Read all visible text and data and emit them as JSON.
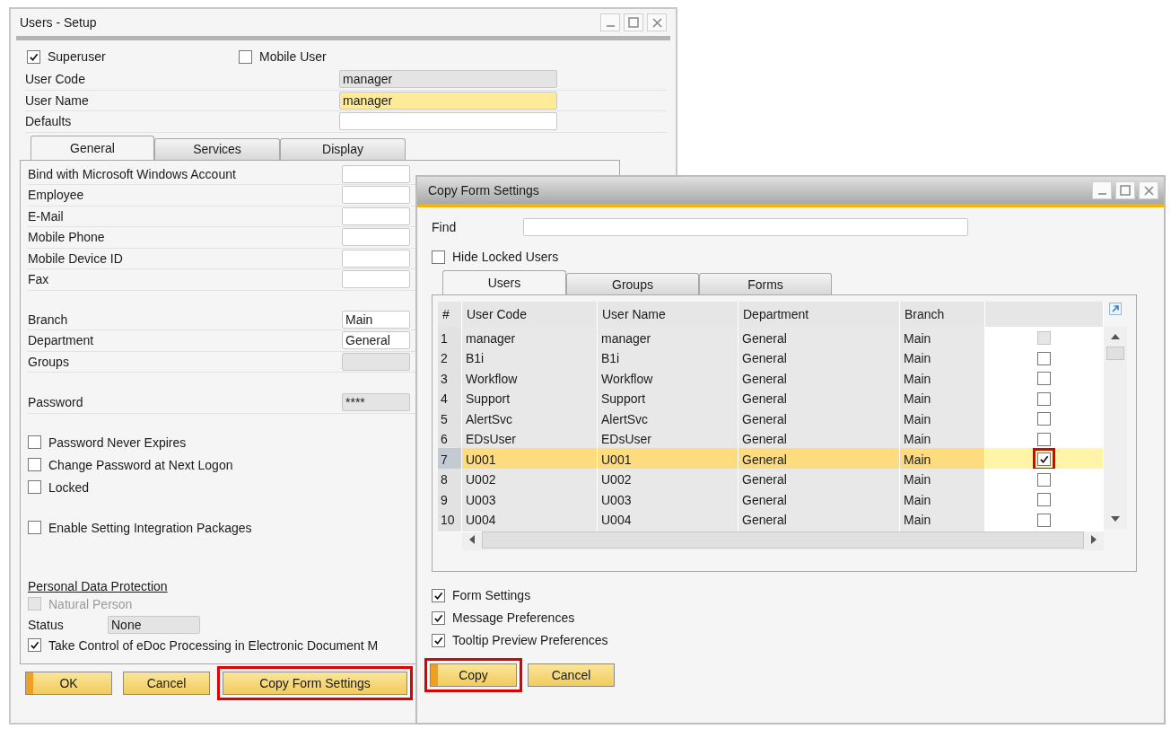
{
  "users_setup": {
    "title": "Users - Setup",
    "top_checks": [
      {
        "label": "Superuser",
        "checked": true
      },
      {
        "label": "Mobile User",
        "checked": false
      }
    ],
    "fields": [
      {
        "label": "User Code",
        "value": "manager",
        "kind": "readonly"
      },
      {
        "label": "User Name",
        "value": "manager",
        "kind": "focused"
      },
      {
        "label": "Defaults",
        "kind": "input"
      }
    ],
    "tabs": [
      {
        "label": "General",
        "selected": true
      },
      {
        "label": "Services",
        "selected": false
      },
      {
        "label": "Display",
        "selected": false
      }
    ],
    "general_field_groups": [
      [
        {
          "label": "Bind with Microsoft Windows Account",
          "kind": "input"
        },
        {
          "label": "Employee",
          "kind": "input"
        },
        {
          "label": "E-Mail",
          "kind": "input"
        },
        {
          "label": "Mobile Phone",
          "kind": "input"
        },
        {
          "label": "Mobile Device ID",
          "kind": "input"
        },
        {
          "label": "Fax",
          "kind": "input"
        }
      ],
      [
        {
          "label": "Branch",
          "value": "Main",
          "kind": "input"
        },
        {
          "label": "Department",
          "value": "General",
          "kind": "input"
        },
        {
          "label": "Groups",
          "kind": "readonly"
        }
      ],
      [
        {
          "label": "Password",
          "value": "****",
          "kind": "readonly"
        }
      ]
    ],
    "option_groups": [
      [
        {
          "label": "Password Never Expires",
          "checked": false
        },
        {
          "label": "Change Password at Next Logon",
          "checked": false
        },
        {
          "label": "Locked",
          "checked": false
        }
      ],
      [
        {
          "label": "Enable Setting Integration Packages",
          "checked": false
        }
      ]
    ],
    "personal_data": {
      "heading": "Personal Data Protection",
      "natural_person": {
        "label": "Natural Person",
        "checked": false,
        "disabled": true
      },
      "status": {
        "label": "Status",
        "value": "None"
      },
      "edoc": {
        "label": "Take Control of eDoc Processing in Electronic Document M",
        "checked": true
      }
    },
    "buttons": [
      {
        "label": "OK",
        "primary": true,
        "highlighted": false
      },
      {
        "label": "Cancel",
        "primary": false,
        "highlighted": false
      },
      {
        "label": "Copy Form Settings",
        "primary": false,
        "highlighted": true
      }
    ]
  },
  "copy_form_settings": {
    "title": "Copy Form Settings",
    "find": {
      "label": "Find"
    },
    "hide_locked": {
      "label": "Hide Locked Users",
      "checked": false
    },
    "tabs": [
      {
        "label": "Users",
        "selected": true
      },
      {
        "label": "Groups",
        "selected": false
      },
      {
        "label": "Forms",
        "selected": false
      }
    ],
    "table": {
      "columns": [
        "#",
        "User Code",
        "User Name",
        "Department",
        "Branch"
      ],
      "rows": [
        {
          "cells": [
            "1",
            "manager",
            "manager",
            "General",
            "Main"
          ],
          "selected": false,
          "checked": false,
          "disabled": true,
          "highlighted": false
        },
        {
          "cells": [
            "2",
            "B1i",
            "B1i",
            "General",
            "Main"
          ],
          "selected": false,
          "checked": false,
          "disabled": false,
          "highlighted": false
        },
        {
          "cells": [
            "3",
            "Workflow",
            "Workflow",
            "General",
            "Main"
          ],
          "selected": false,
          "checked": false,
          "disabled": false,
          "highlighted": false
        },
        {
          "cells": [
            "4",
            "Support",
            "Support",
            "General",
            "Main"
          ],
          "selected": false,
          "checked": false,
          "disabled": false,
          "highlighted": false
        },
        {
          "cells": [
            "5",
            "AlertSvc",
            "AlertSvc",
            "General",
            "Main"
          ],
          "selected": false,
          "checked": false,
          "disabled": false,
          "highlighted": false
        },
        {
          "cells": [
            "6",
            "EDsUser",
            "EDsUser",
            "General",
            "Main"
          ],
          "selected": false,
          "checked": false,
          "disabled": false,
          "highlighted": false
        },
        {
          "cells": [
            "7",
            "U001",
            "U001",
            "General",
            "Main"
          ],
          "selected": true,
          "checked": true,
          "disabled": false,
          "highlighted": true
        },
        {
          "cells": [
            "8",
            "U002",
            "U002",
            "General",
            "Main"
          ],
          "selected": false,
          "checked": false,
          "disabled": false,
          "highlighted": false
        },
        {
          "cells": [
            "9",
            "U003",
            "U003",
            "General",
            "Main"
          ],
          "selected": false,
          "checked": false,
          "disabled": false,
          "highlighted": false
        },
        {
          "cells": [
            "10",
            "U004",
            "U004",
            "General",
            "Main"
          ],
          "selected": false,
          "checked": false,
          "disabled": false,
          "highlighted": false
        }
      ]
    },
    "copy_options": [
      {
        "label": "Form Settings",
        "checked": true
      },
      {
        "label": "Message Preferences",
        "checked": true
      },
      {
        "label": "Tooltip Preview Preferences",
        "checked": true
      }
    ],
    "buttons": [
      {
        "label": "Copy",
        "primary": true,
        "highlighted": true
      },
      {
        "label": "Cancel",
        "primary": false,
        "highlighted": false
      }
    ]
  }
}
